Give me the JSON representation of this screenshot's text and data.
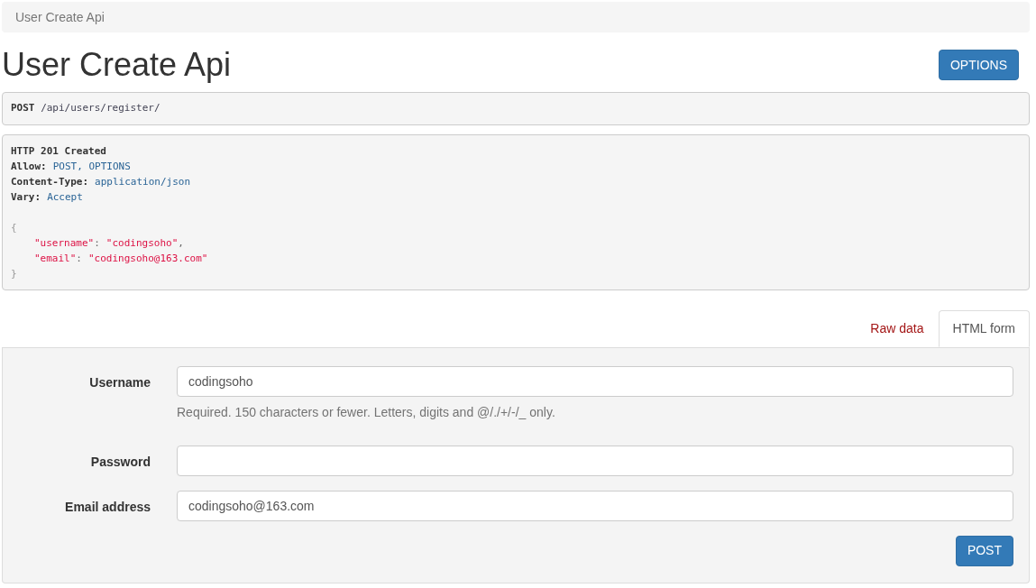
{
  "breadcrumb": "User Create Api",
  "title": "User Create Api",
  "options_button": "OPTIONS",
  "request": {
    "method": "POST",
    "path": "/api/users/register/"
  },
  "response": {
    "status": "HTTP 201 Created",
    "headers": [
      {
        "name": "Allow:",
        "value": "POST, OPTIONS"
      },
      {
        "name": "Content-Type:",
        "value": "application/json"
      },
      {
        "name": "Vary:",
        "value": "Accept"
      }
    ],
    "open": "{",
    "entries": [
      {
        "key": "\"username\"",
        "colon": ":",
        "value": "\"codingsoho\"",
        "comma": ","
      },
      {
        "key": "\"email\"",
        "colon": ":",
        "value": "\"codingsoho@163.com\""
      }
    ],
    "close": "}"
  },
  "tabs": [
    {
      "label": "Raw data",
      "selected": false
    },
    {
      "label": "HTML form",
      "selected": true
    }
  ],
  "form": {
    "fields": [
      {
        "label": "Username",
        "value": "codingsoho",
        "help": "Required. 150 characters or fewer. Letters, digits and @/./+/-/_ only."
      },
      {
        "label": "Password"
      },
      {
        "label": "Email address",
        "value": "codingsoho@163.com"
      }
    ],
    "submit": "POST"
  }
}
